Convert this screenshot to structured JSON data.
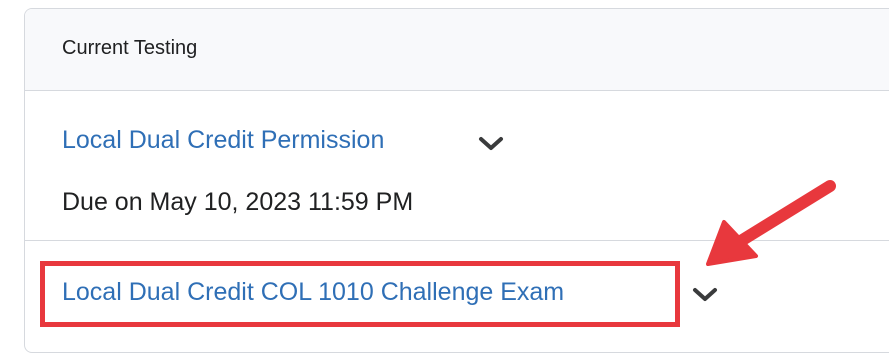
{
  "panel": {
    "title": "Current Testing",
    "items": [
      {
        "title": "Local Dual Credit Permission",
        "due": "Due on May 10, 2023 11:59 PM"
      },
      {
        "title": "Local Dual Credit COL 1010 Challenge Exam"
      }
    ]
  },
  "icons": {
    "expand": "chevron-down-icon"
  },
  "annotation": {
    "color": "#e8383d"
  }
}
